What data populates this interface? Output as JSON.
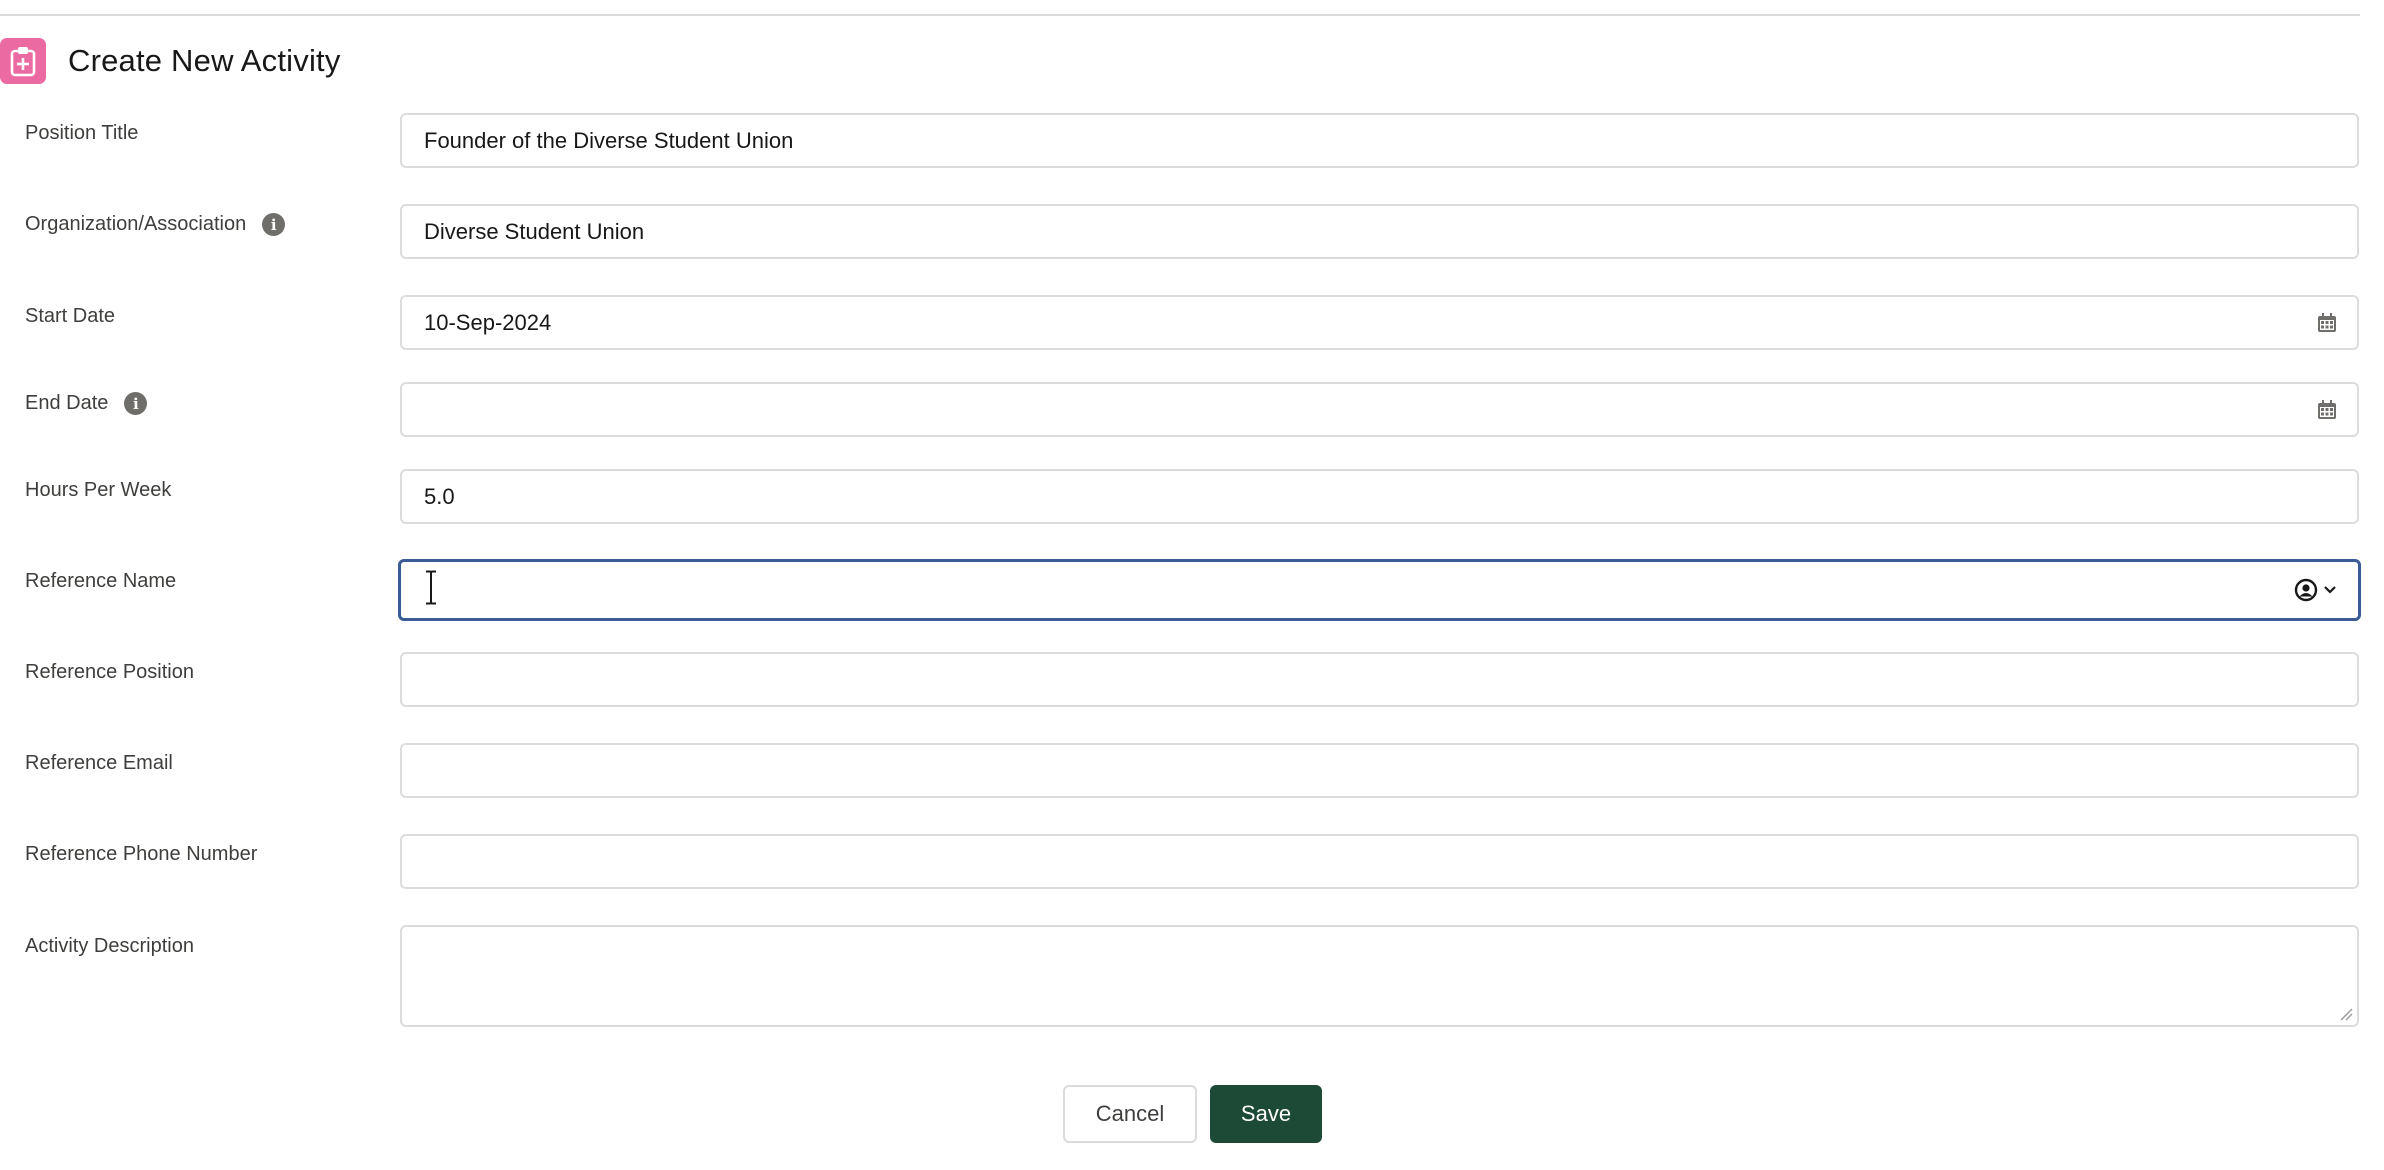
{
  "header": {
    "title": "Create New Activity",
    "icon": "clipboard-plus-icon",
    "icon_color": "#ec6aa2"
  },
  "form": {
    "position_title": {
      "label": "Position Title",
      "value": "Founder of the Diverse Student Union"
    },
    "organization": {
      "label": "Organization/Association",
      "value": "Diverse Student Union",
      "info_icon": "info-icon"
    },
    "start_date": {
      "label": "Start Date",
      "value": "10-Sep-2024",
      "icon": "calendar-icon"
    },
    "end_date": {
      "label": "End Date",
      "value": "",
      "info_icon": "info-icon",
      "icon": "calendar-icon"
    },
    "hours_per_week": {
      "label": "Hours Per Week",
      "value": "5.0"
    },
    "reference_name": {
      "label": "Reference Name",
      "value": "",
      "icon": "user-circle-icon",
      "dropdown_icon": "chevron-down-icon",
      "focus_color": "#3b5b95"
    },
    "reference_position": {
      "label": "Reference Position",
      "value": ""
    },
    "reference_email": {
      "label": "Reference Email",
      "value": ""
    },
    "reference_phone": {
      "label": "Reference Phone Number",
      "value": ""
    },
    "activity_description": {
      "label": "Activity Description",
      "value": ""
    }
  },
  "actions": {
    "cancel_label": "Cancel",
    "save_label": "Save",
    "save_color": "#1d4a37"
  }
}
